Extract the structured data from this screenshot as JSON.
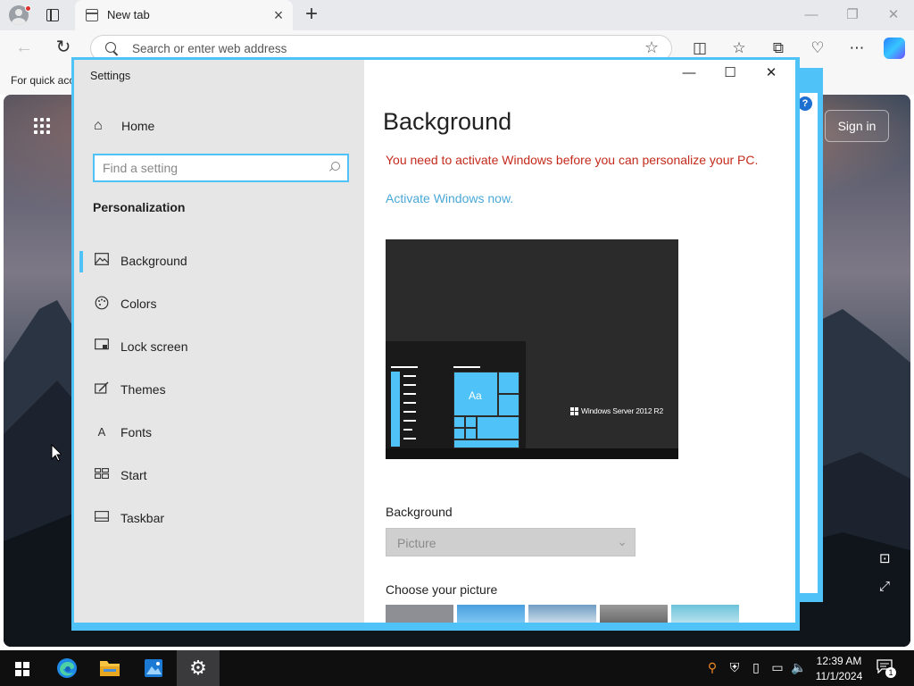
{
  "browser": {
    "tab_title": "New tab",
    "address_placeholder": "Search or enter web address",
    "favorites_bar_text": "For quick acc",
    "signin_label": "Sign in"
  },
  "settings": {
    "window_title": "Settings",
    "home_label": "Home",
    "search_placeholder": "Find a setting",
    "section_title": "Personalization",
    "nav_items": [
      {
        "label": "Background",
        "icon": "picture-icon",
        "selected": true
      },
      {
        "label": "Colors",
        "icon": "palette-icon",
        "selected": false
      },
      {
        "label": "Lock screen",
        "icon": "lock-screen-icon",
        "selected": false
      },
      {
        "label": "Themes",
        "icon": "brush-icon",
        "selected": false
      },
      {
        "label": "Fonts",
        "icon": "font-icon",
        "selected": false
      },
      {
        "label": "Start",
        "icon": "start-tiles-icon",
        "selected": false
      },
      {
        "label": "Taskbar",
        "icon": "taskbar-icon",
        "selected": false
      }
    ],
    "heading": "Background",
    "warning": "You need to activate Windows before you can personalize your PC.",
    "activate_link": "Activate Windows now.",
    "preview_aa": "Aa",
    "preview_brand": "Windows Server 2012 R2",
    "background_label": "Background",
    "background_value": "Picture",
    "choose_picture_label": "Choose your picture"
  },
  "taskbar": {
    "time": "12:39 AM",
    "date": "11/1/2024",
    "notification_count": "1"
  },
  "colors": {
    "accent": "#4fc3f7",
    "warning": "#c42b1c",
    "link": "#4aa8d8"
  }
}
